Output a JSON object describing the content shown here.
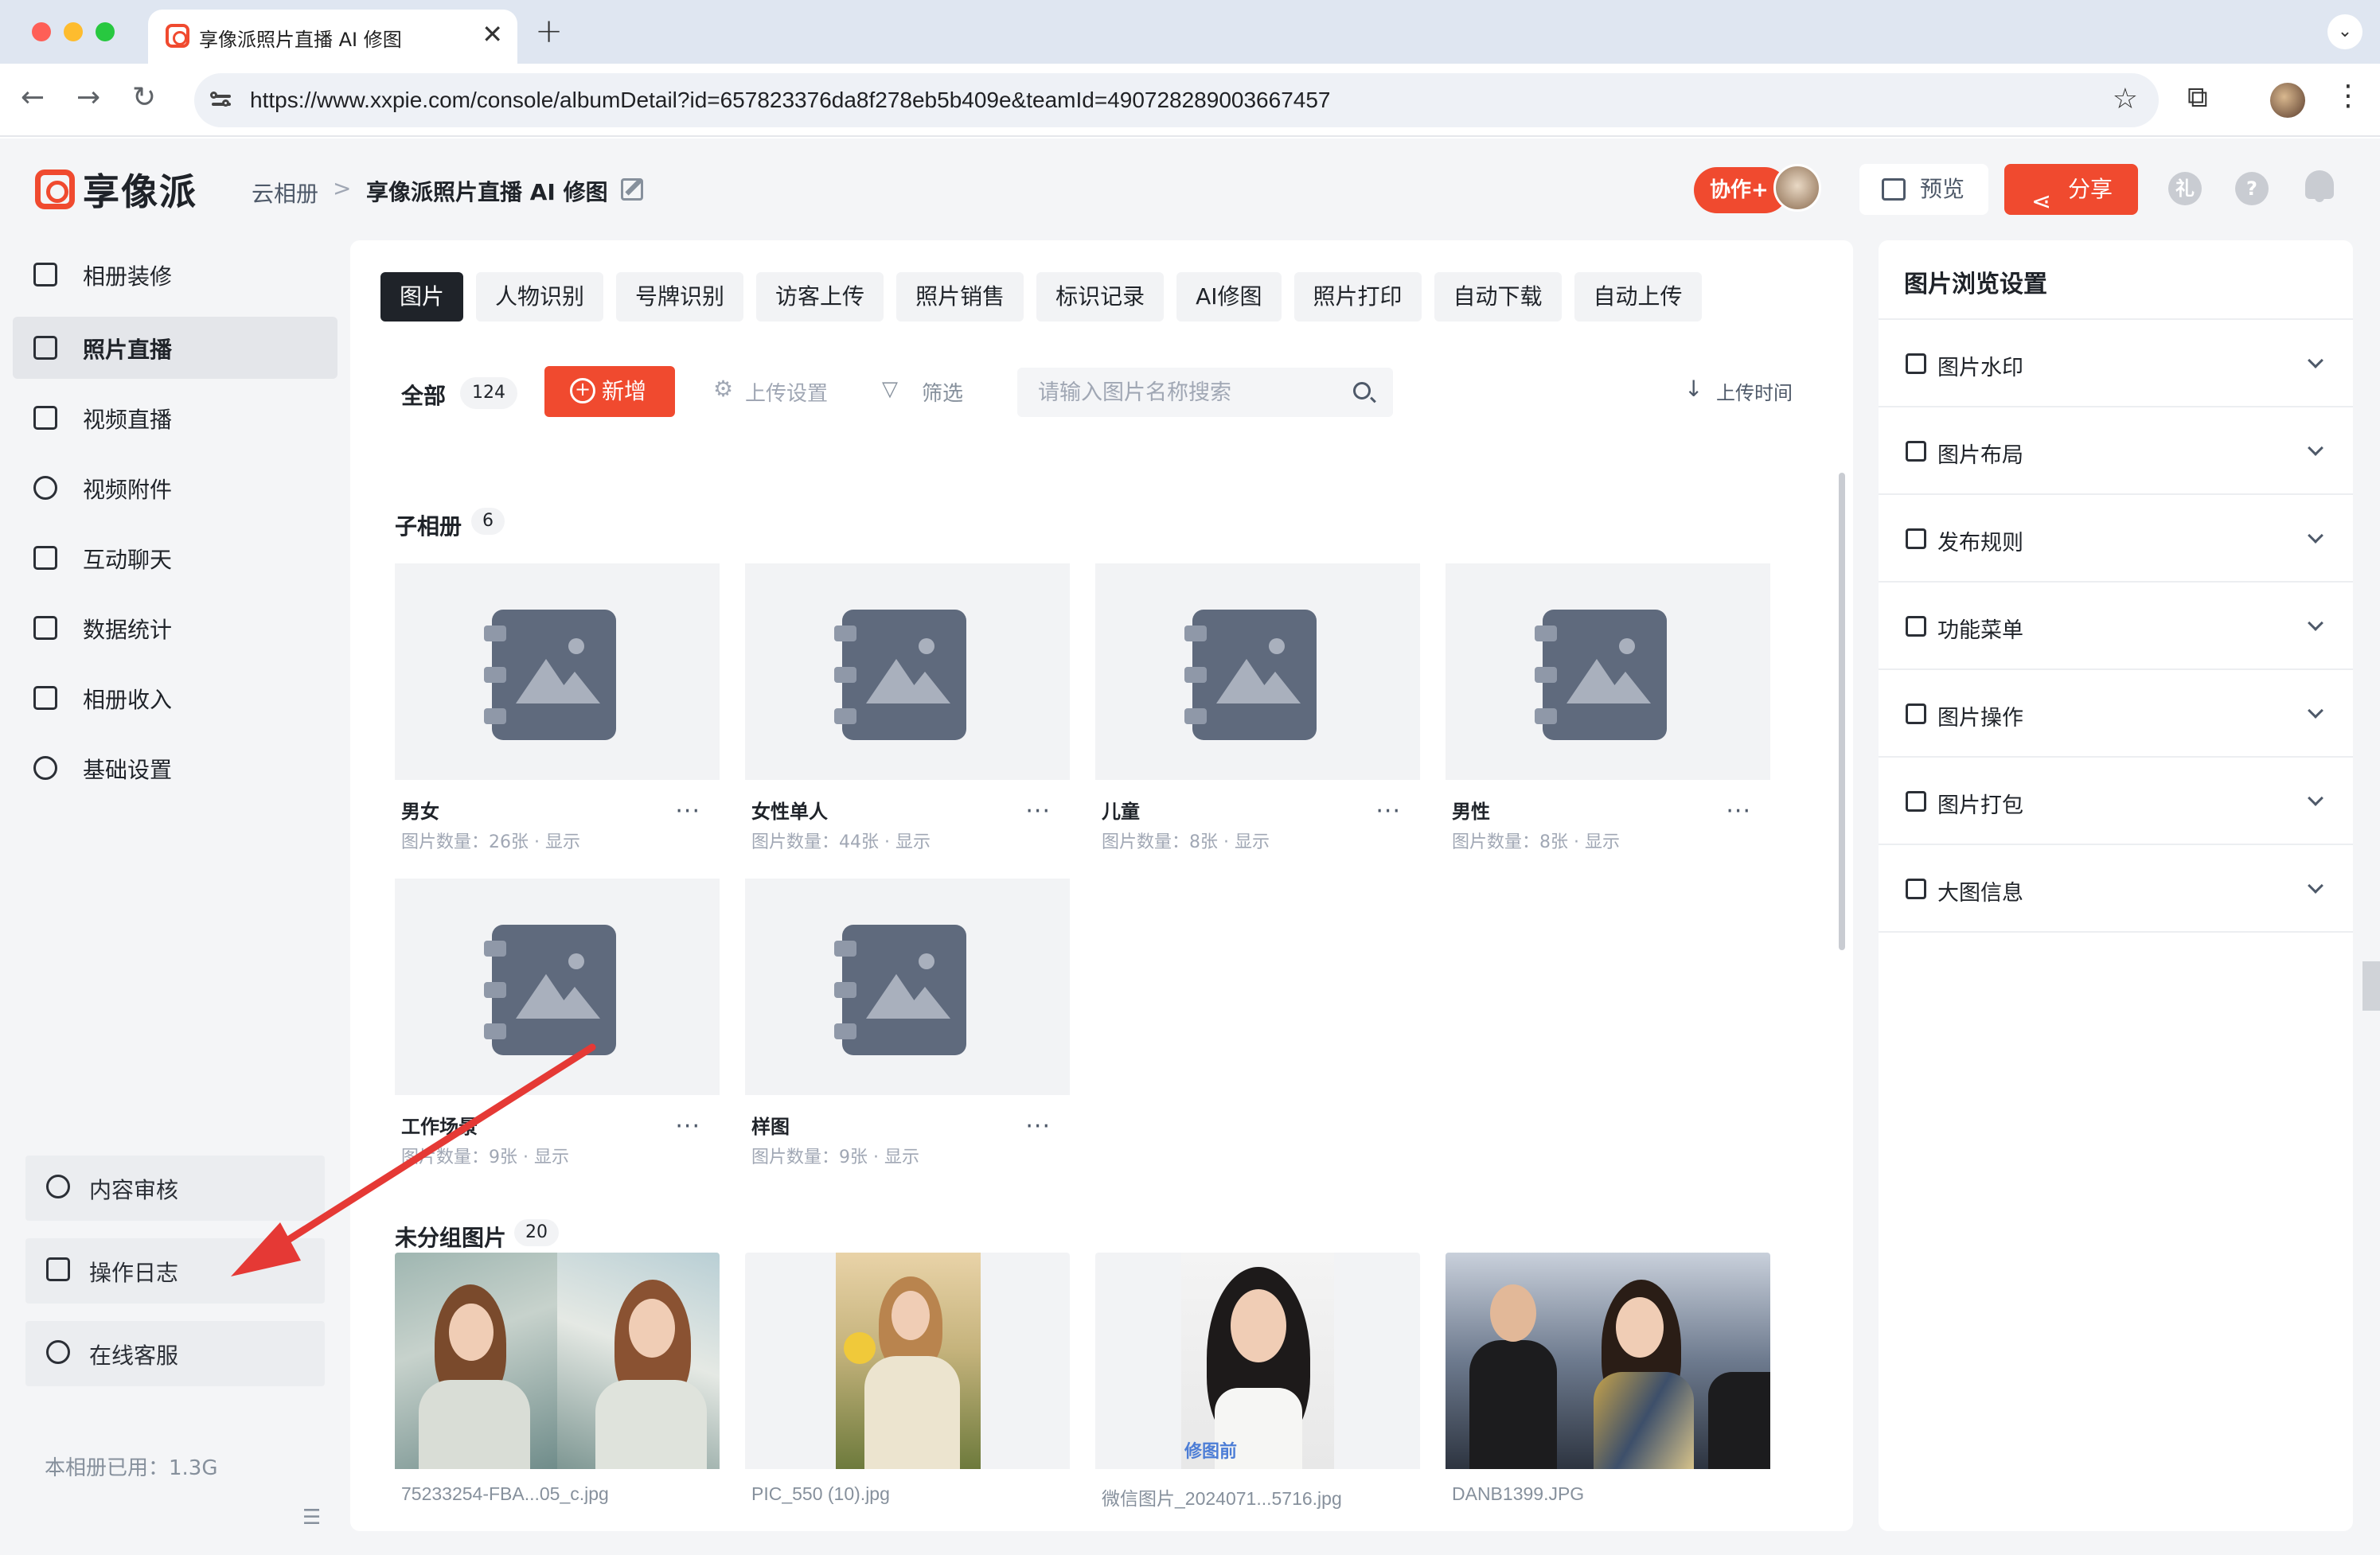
{
  "browser": {
    "tab_title": "享像派照片直播 AI 修图",
    "tab_close": "✕",
    "new_tab": "+",
    "url": "https://www.xxpie.com/console/albumDetail?id=657823376da8f278eb5b409e&teamId=490728289003667457"
  },
  "header": {
    "logo_text": "享像派",
    "breadcrumb_root": "云相册",
    "breadcrumb_sep": ">",
    "album_title": "享像派照片直播 AI 修图",
    "collab_label": "协作+",
    "preview_label": "预览",
    "share_label": "分享"
  },
  "sidebar": {
    "items": [
      {
        "label": "相册装修",
        "icon": "decorate-icon"
      },
      {
        "label": "照片直播",
        "icon": "photo-icon"
      },
      {
        "label": "视频直播",
        "icon": "video-icon"
      },
      {
        "label": "视频附件",
        "icon": "paperclip-icon"
      },
      {
        "label": "互动聊天",
        "icon": "chat-icon"
      },
      {
        "label": "数据统计",
        "icon": "stats-icon"
      },
      {
        "label": "相册收入",
        "icon": "store-icon"
      },
      {
        "label": "基础设置",
        "icon": "gear-icon"
      }
    ],
    "active_index": 1,
    "cards": [
      {
        "label": "内容审核",
        "icon": "stamp-icon"
      },
      {
        "label": "操作日志",
        "icon": "log-icon"
      },
      {
        "label": "在线客服",
        "icon": "headset-icon"
      }
    ],
    "storage": "本相册已用：1.3G"
  },
  "main": {
    "tabs": [
      "图片",
      "人物识别",
      "号牌识别",
      "访客上传",
      "照片销售",
      "标识记录",
      "AI修图",
      "照片打印",
      "自动下载",
      "自动上传"
    ],
    "active_tab": 0,
    "all_label": "全部",
    "all_count": "124",
    "add_label": "新增",
    "upload_settings_label": "上传设置",
    "filter_label": "筛选",
    "search_placeholder": "请输入图片名称搜索",
    "sort_label": "上传时间",
    "subalbums_title": "子相册",
    "subalbums_count": "6",
    "subalbums": [
      {
        "name": "男女",
        "meta": "图片数量：26张 · 显示"
      },
      {
        "name": "女性单人",
        "meta": "图片数量：44张 · 显示"
      },
      {
        "name": "儿童",
        "meta": "图片数量：8张 · 显示"
      },
      {
        "name": "男性",
        "meta": "图片数量：8张 · 显示"
      },
      {
        "name": "工作场景",
        "meta": "图片数量：9张 · 显示"
      },
      {
        "name": "样图",
        "meta": "图片数量：9张 · 显示"
      }
    ],
    "more_label": "···",
    "ungrouped_title": "未分组图片",
    "ungrouped_count": "20",
    "photos": [
      {
        "name": "75233254-FBA...05_c.jpg"
      },
      {
        "name": "PIC_550 (10).jpg"
      },
      {
        "name": "微信图片_2024071...5716.jpg"
      },
      {
        "name": "DANB1399.JPG"
      }
    ],
    "watermark_text": "修图前"
  },
  "settings": {
    "title": "图片浏览设置",
    "rows": [
      {
        "label": "图片水印",
        "icon": "watermark-icon"
      },
      {
        "label": "图片布局",
        "icon": "layout-icon"
      },
      {
        "label": "发布规则",
        "icon": "rules-icon"
      },
      {
        "label": "功能菜单",
        "icon": "menu-icon"
      },
      {
        "label": "图片操作",
        "icon": "operation-icon"
      },
      {
        "label": "图片打包",
        "icon": "package-icon"
      },
      {
        "label": "大图信息",
        "icon": "image-info-icon"
      }
    ]
  },
  "colors": {
    "brand": "#f04a2f",
    "annotation_arrow": "#e53935"
  }
}
